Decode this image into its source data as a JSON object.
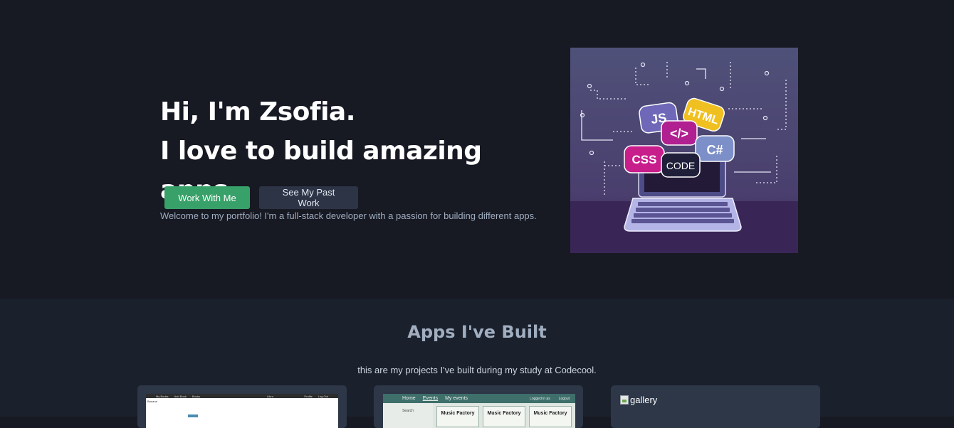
{
  "hero": {
    "line1": "Hi, I'm Zsofia.",
    "line2": "I love to build amazing apps.",
    "subtitle": "Welcome to my portfolio! I'm a full-stack developer with a passion for building different apps.",
    "primary_button": "Work With Me",
    "secondary_button": "See My Past Work",
    "illustration": {
      "badges": [
        "JS",
        "HTML",
        "</>",
        "CSS",
        "C#",
        "CODE"
      ]
    }
  },
  "apps": {
    "title": "Apps I've Built",
    "subtitle": "this are my projects I've built during my study at Codecool.",
    "cards": [
      {
        "screenshot_nav": [
          "My Books",
          "Add Book",
          "Books"
        ],
        "screenshot_center": "Libro",
        "screenshot_right": [
          "Profile",
          "Log Out"
        ],
        "screenshot_label": "Banana"
      },
      {
        "screenshot_nav": [
          "Home",
          "Events",
          "My events"
        ],
        "screenshot_right": [
          "Logged in as",
          "Logout"
        ],
        "screenshot_side": "Search",
        "screenshot_tiles": [
          "Music Factory",
          "Music Factory",
          "Music Factory"
        ]
      },
      {
        "alt_text": "gallery"
      }
    ]
  },
  "colors": {
    "background": "#171923",
    "section": "#1a202c",
    "card": "#2d3748",
    "primary": "#38a169",
    "secondary": "#2d3446"
  }
}
